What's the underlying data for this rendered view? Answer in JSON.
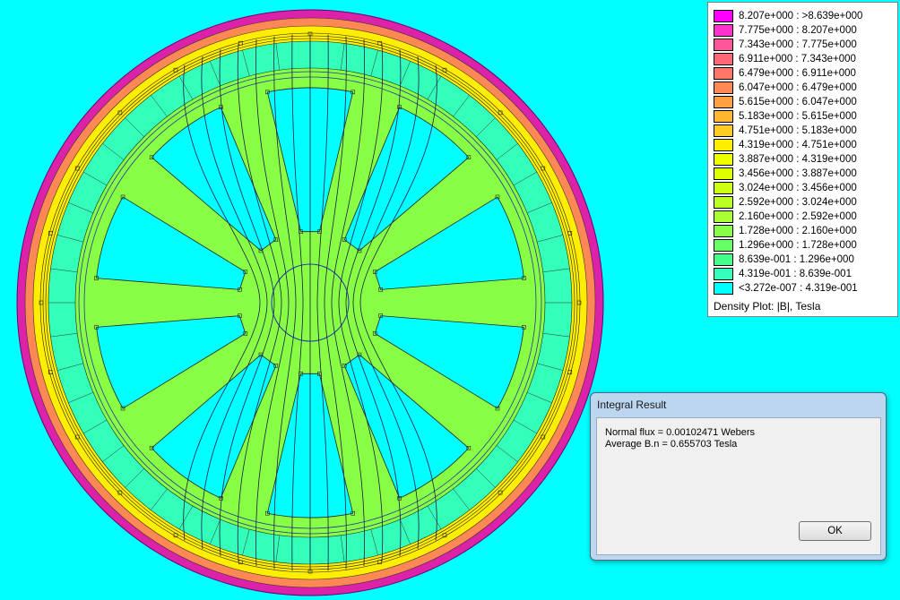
{
  "legend": {
    "entries": [
      {
        "label": "8.207e+000 : >8.639e+000",
        "color": "#ff00ff"
      },
      {
        "label": "7.775e+000 : 8.207e+000",
        "color": "#ff33cc"
      },
      {
        "label": "7.343e+000 : 7.775e+000",
        "color": "#ff5599"
      },
      {
        "label": "6.911e+000 : 7.343e+000",
        "color": "#ff6677"
      },
      {
        "label": "6.479e+000 : 6.911e+000",
        "color": "#ff7766"
      },
      {
        "label": "6.047e+000 : 6.479e+000",
        "color": "#ff8855"
      },
      {
        "label": "5.615e+000 : 6.047e+000",
        "color": "#ffa040"
      },
      {
        "label": "5.183e+000 : 5.615e+000",
        "color": "#ffb830"
      },
      {
        "label": "4.751e+000 : 5.183e+000",
        "color": "#ffcc22"
      },
      {
        "label": "4.319e+000 : 4.751e+000",
        "color": "#ffee00"
      },
      {
        "label": "3.887e+000 : 4.319e+000",
        "color": "#f0ff00"
      },
      {
        "label": "3.456e+000 : 3.887e+000",
        "color": "#ddff00"
      },
      {
        "label": "3.024e+000 : 3.456e+000",
        "color": "#ccff11"
      },
      {
        "label": "2.592e+000 : 3.024e+000",
        "color": "#bbff22"
      },
      {
        "label": "2.160e+000 : 2.592e+000",
        "color": "#aaff33"
      },
      {
        "label": "1.728e+000 : 2.160e+000",
        "color": "#88ff44"
      },
      {
        "label": "1.296e+000 : 1.728e+000",
        "color": "#66ff66"
      },
      {
        "label": "8.639e-001 : 1.296e+000",
        "color": "#44ff88"
      },
      {
        "label": "4.319e-001 : 8.639e-001",
        "color": "#33ffbb"
      },
      {
        "label": "<3.272e-007 : 4.319e-001",
        "color": "#00ffff"
      }
    ],
    "caption": "Density Plot: |B|, Tesla"
  },
  "dialog": {
    "title": "Integral Result",
    "line1": "Normal flux = 0.00102471 Webers",
    "line2": "Average B.n = 0.655703 Tesla",
    "ok_label": "OK"
  },
  "plot": {
    "background": "#00ffff",
    "ring_outer_color": "#dd22aa",
    "ring_mid_color": "#ff8855",
    "ring_inner_color": "#ffee00",
    "rotor_color": "#88ff44",
    "rotor_light_color": "#33ffbb",
    "line_color": "#1a1a4a",
    "boundary_color": "#2233aa"
  }
}
